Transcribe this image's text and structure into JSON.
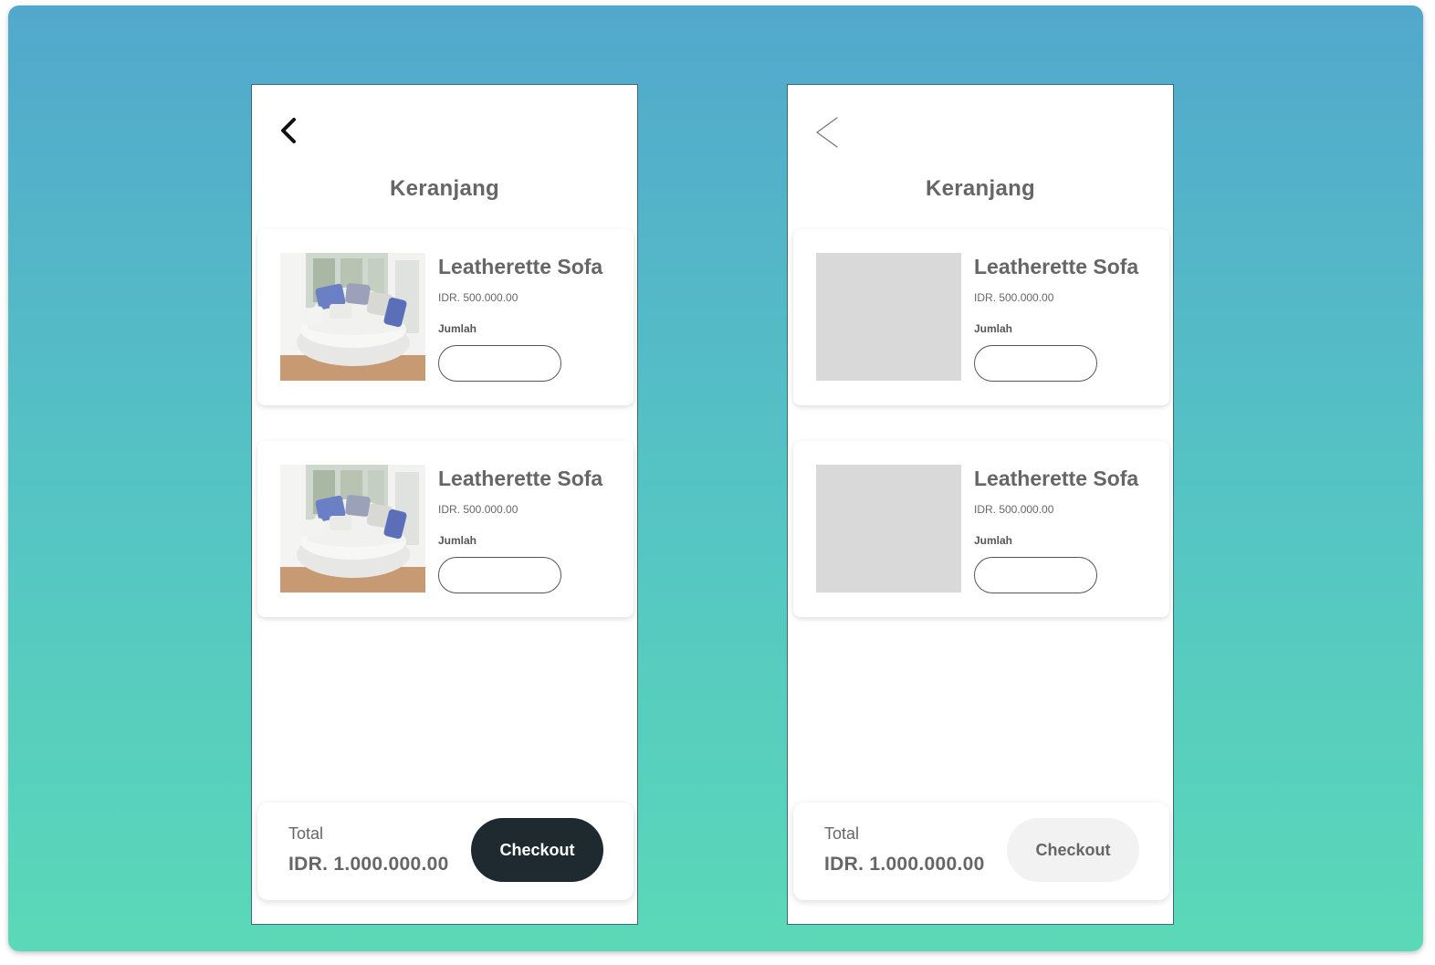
{
  "screens": [
    {
      "variant": "hifi",
      "back_icon": "chevron-left-icon",
      "title": "Keranjang",
      "items": [
        {
          "name": "Leatherette Sofa",
          "price": "IDR. 500.000.00",
          "qty_label": "Jumlah",
          "qty_value": ""
        },
        {
          "name": "Leatherette Sofa",
          "price": "IDR. 500.000.00",
          "qty_label": "Jumlah",
          "qty_value": ""
        }
      ],
      "total_label": "Total",
      "total_value": "IDR. 1.000.000.00",
      "checkout_label": "Checkout"
    },
    {
      "variant": "wireframe",
      "back_icon": "chevron-left-thin-icon",
      "title": "Keranjang",
      "items": [
        {
          "name": "Leatherette Sofa",
          "price": "IDR. 500.000.00",
          "qty_label": "Jumlah",
          "qty_value": ""
        },
        {
          "name": "Leatherette Sofa",
          "price": "IDR. 500.000.00",
          "qty_label": "Jumlah",
          "qty_value": ""
        }
      ],
      "total_label": "Total",
      "total_value": "IDR. 1.000.000.00",
      "checkout_label": "Checkout"
    }
  ],
  "colors": {
    "gradient_top": "#52a8cc",
    "gradient_bottom": "#5ad9b8",
    "checkout_dark": "#1f2a30",
    "checkout_light": "#f2f2f2",
    "placeholder": "#d9d9d9",
    "text_gray": "#666666"
  }
}
